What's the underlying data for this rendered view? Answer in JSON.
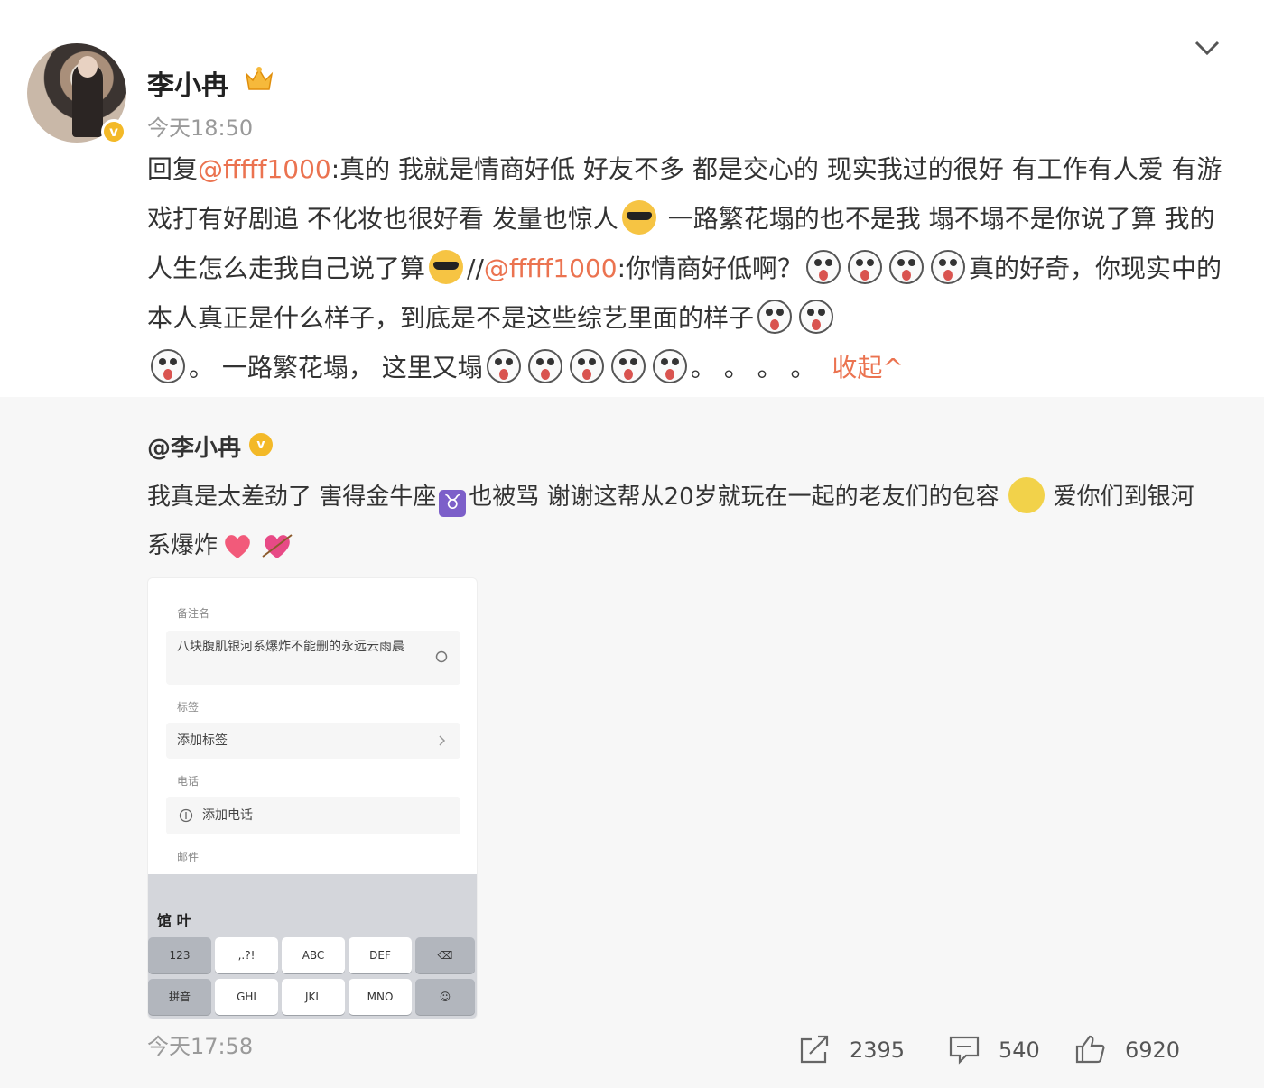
{
  "post": {
    "username": "李小冉",
    "time": "今天18:50",
    "content": {
      "p1": "回复",
      "mention1": "@fffff1000",
      "p2": ":真的 我就是情商好低 好友不多 都是交心的 现实我过的很好 有工作有人爱 有游戏打有好剧追 不化妆也很好看 发量也惊人",
      "p3": " 一路繁花塌的也不是我 塌不塌不是你说了算 我的人生怎么走我自己说了算",
      "p4": "//",
      "mention2": "@fffff1000",
      "p5": ":你情商好低啊？",
      "p6": "真的好奇，你现实中的本人真正是什么样子，到底是不是这些综艺里面的样子",
      "p7": "。 一路繁花塌， 这里又塌",
      "p8": "。 。 。 。",
      "collapse": "收起^"
    }
  },
  "quote": {
    "user": "@李小冉",
    "text1": "我真是太差劲了 害得金牛座",
    "text2": "也被骂 谢谢这帮从20岁就玩在一起的老友们的包容",
    "text3": "爱你们到银河系爆炸",
    "taurus": "♉",
    "image": {
      "label_note": "备注名",
      "note_value": "八块腹肌银河系爆炸不能删的永远云雨晨",
      "label_tag": "标签",
      "tag_value": "添加标签",
      "label_phone": "电话",
      "phone_value": "添加电话",
      "label_email": "邮件",
      "candidates": "馆 叶",
      "keys": [
        "123",
        ",.?!",
        "ABC",
        "DEF",
        "拼音",
        "GHI",
        "JKL",
        "MNO"
      ]
    },
    "time": "今天17:58",
    "reposts": "2395",
    "comments": "540",
    "likes": "6920"
  }
}
